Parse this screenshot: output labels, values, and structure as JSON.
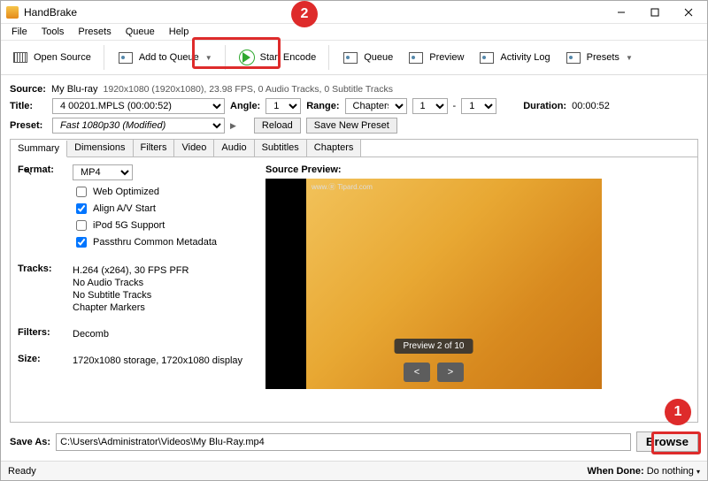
{
  "window": {
    "title": "HandBrake"
  },
  "menu": {
    "file": "File",
    "tools": "Tools",
    "presets": "Presets",
    "queue": "Queue",
    "help": "Help"
  },
  "toolbar": {
    "open": "Open Source",
    "add": "Add to Queue",
    "start": "Start Encode",
    "queue": "Queue",
    "preview": "Preview",
    "activity": "Activity Log",
    "presets": "Presets"
  },
  "source": {
    "label": "Source:",
    "name": "My Blu-ray",
    "info": "1920x1080 (1920x1080), 23.98 FPS, 0 Audio Tracks, 0 Subtitle Tracks"
  },
  "title": {
    "label": "Title:",
    "value": "4 00201.MPLS (00:00:52)",
    "angle_label": "Angle:",
    "angle": "1",
    "range_label": "Range:",
    "range_type": "Chapters",
    "range_from": "1",
    "range_sep": "-",
    "range_to": "1",
    "duration_label": "Duration:",
    "duration": "00:00:52"
  },
  "preset": {
    "label": "Preset:",
    "value": "Fast 1080p30  (Modified)",
    "reload": "Reload",
    "save": "Save New Preset"
  },
  "tabs": {
    "summary": "Summary",
    "dimensions": "Dimensions",
    "filters": "Filters",
    "video": "Video",
    "audio": "Audio",
    "subtitles": "Subtitles",
    "chapters": "Chapters"
  },
  "summary": {
    "format_label": "Format:",
    "format": "MP4",
    "cb_web": "Web Optimized",
    "cb_align": "Align A/V Start",
    "cb_ipod": "iPod 5G Support",
    "cb_meta": "Passthru Common Metadata",
    "tracks_label": "Tracks:",
    "track_video": "H.264 (x264), 30 FPS PFR",
    "track_audio": "No Audio Tracks",
    "track_sub": "No Subtitle Tracks",
    "track_chap": "Chapter Markers",
    "filters_label": "Filters:",
    "filters": "Decomb",
    "size_label": "Size:",
    "size": "1720x1080 storage, 1720x1080 display",
    "preview_label": "Source Preview:",
    "preview_badge": "Preview 2 of 10",
    "prev_btn": "<",
    "next_btn": ">",
    "watermark": "www.Ⓡ Tipard.com"
  },
  "saveas": {
    "label": "Save As:",
    "path": "C:\\Users\\Administrator\\Videos\\My Blu-Ray.mp4",
    "browse": "Browse"
  },
  "status": {
    "ready": "Ready",
    "when_done_label": "When Done:",
    "when_done": "Do nothing"
  },
  "annot": {
    "one": "1",
    "two": "2"
  }
}
